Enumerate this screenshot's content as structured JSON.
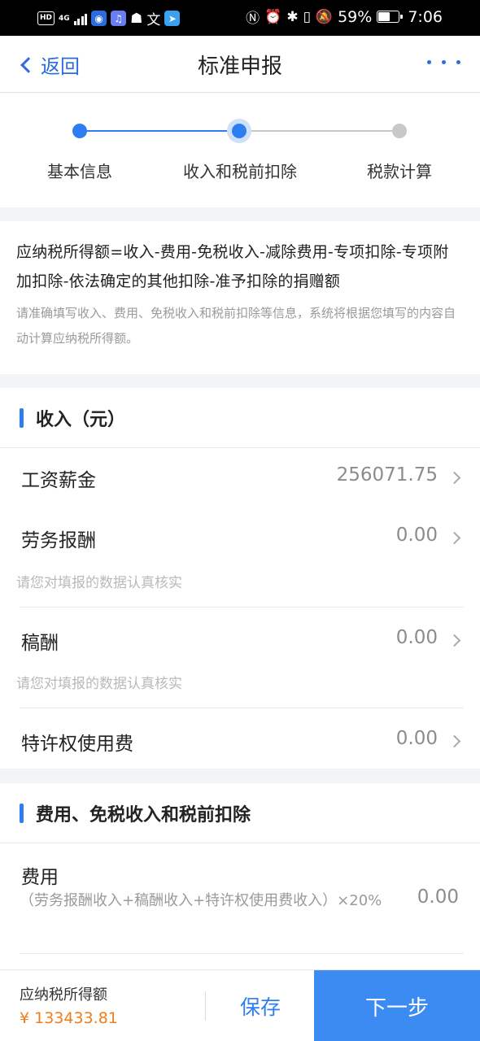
{
  "status_bar": {
    "hd": "HD",
    "net": "4G",
    "battery": "59%",
    "battery_level": 0.59,
    "time": "7:06"
  },
  "navbar": {
    "back_label": "返回",
    "title": "标准申报"
  },
  "stepper": {
    "steps": [
      {
        "label": "基本信息",
        "state": "done"
      },
      {
        "label": "收入和税前扣除",
        "state": "current"
      },
      {
        "label": "税款计算",
        "state": "todo"
      }
    ],
    "colors": {
      "active": "#2f7ef1",
      "inactive": "#c8c8c8"
    }
  },
  "formula": {
    "main": "应纳税所得额=收入-费用-免税收入-减除费用-专项扣除-专项附加扣除-依法确定的其他扣除-准予扣除的捐赠额",
    "note": "请准确填写收入、费用、免税收入和税前扣除等信息，系统将根据您填写的内容自动计算应纳税所得额。"
  },
  "income_section": {
    "title": "收入（元）",
    "rows": [
      {
        "label": "工资薪金",
        "value": "256071.75",
        "hint": ""
      },
      {
        "label": "劳务报酬",
        "value": "0.00",
        "hint": "请您对填报的数据认真核实"
      },
      {
        "label": "稿酬",
        "value": "0.00",
        "hint": "请您对填报的数据认真核实"
      },
      {
        "label": "特许权使用费",
        "value": "0.00",
        "hint": ""
      }
    ]
  },
  "expense_section": {
    "title": "费用、免税收入和税前扣除",
    "rows": [
      {
        "label": "费用",
        "formula": "（劳务报酬收入+稿酬收入+特许权使用费收入）×20%",
        "value": "0.00"
      }
    ]
  },
  "bottom_bar": {
    "label": "应纳税所得额",
    "amount": "¥ 133433.81",
    "save_label": "保存",
    "next_label": "下一步"
  },
  "accent_color": "#2f7ef1",
  "amount_color": "#f07d17"
}
